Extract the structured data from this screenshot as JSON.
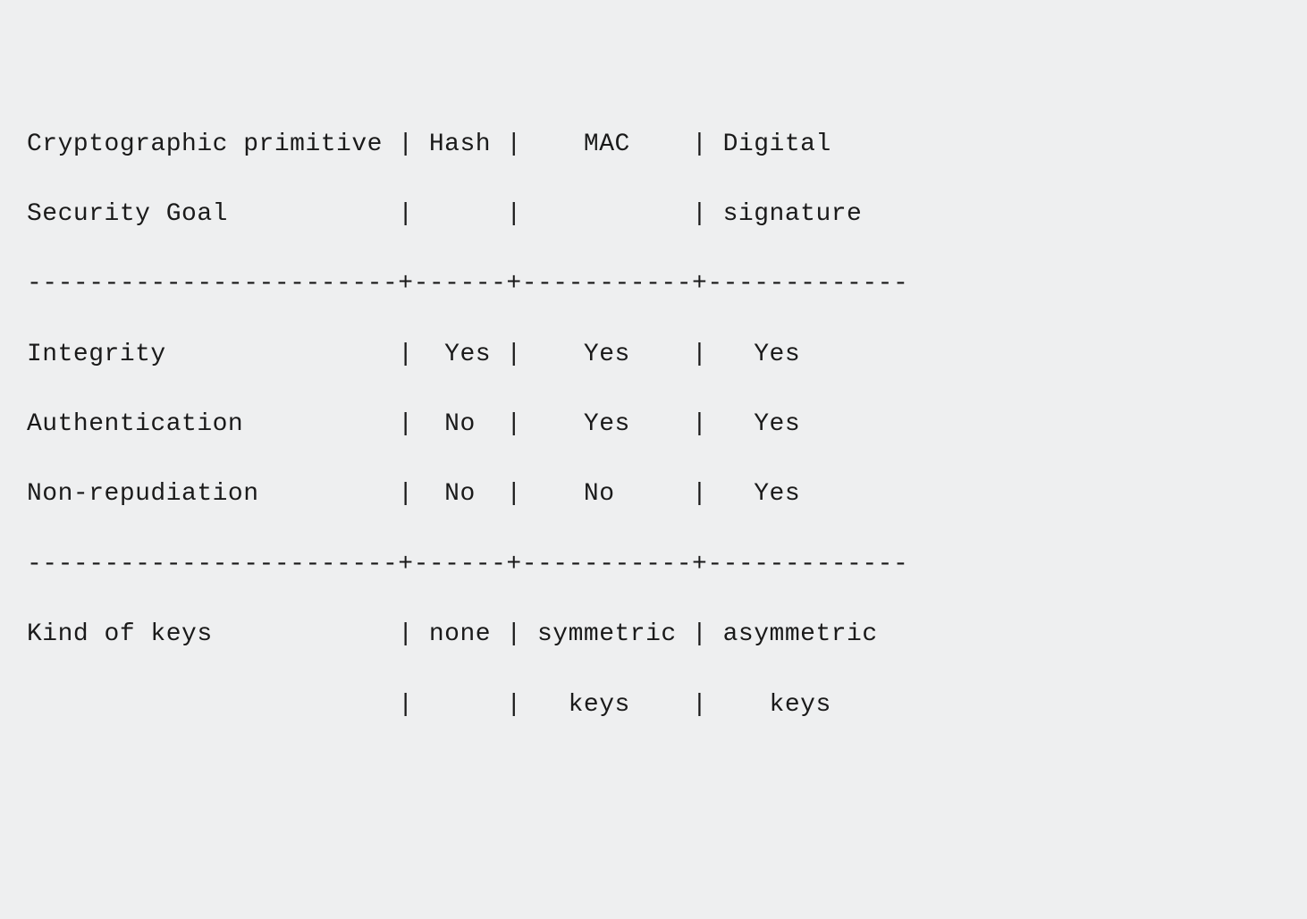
{
  "table": {
    "lines": [
      "Cryptographic primitive | Hash |    MAC    | Digital",
      "Security Goal           |      |           | signature",
      "------------------------+------+-----------+-------------",
      "Integrity               |  Yes |    Yes    |   Yes",
      "Authentication          |  No  |    Yes    |   Yes",
      "Non-repudiation         |  No  |    No     |   Yes",
      "------------------------+------+-----------+-------------",
      "Kind of keys            | none | symmetric | asymmetric",
      "                        |      |   keys    |    keys"
    ]
  },
  "chart_data": {
    "type": "table",
    "title": "Cryptographic primitive vs Security Goal",
    "columns": [
      "",
      "Hash",
      "MAC",
      "Digital signature"
    ],
    "rows": [
      {
        "label": "Integrity",
        "values": [
          "Yes",
          "Yes",
          "Yes"
        ]
      },
      {
        "label": "Authentication",
        "values": [
          "No",
          "Yes",
          "Yes"
        ]
      },
      {
        "label": "Non-repudiation",
        "values": [
          "No",
          "No",
          "Yes"
        ]
      },
      {
        "label": "Kind of keys",
        "values": [
          "none",
          "symmetric keys",
          "asymmetric keys"
        ]
      }
    ]
  }
}
